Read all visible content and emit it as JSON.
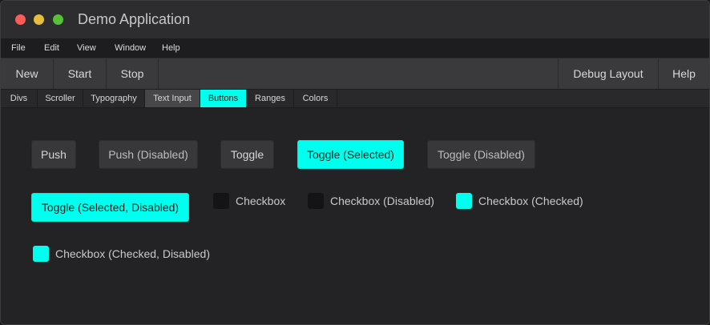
{
  "window": {
    "title": "Demo Application",
    "controls": [
      {
        "name": "close-button",
        "color": "#fc5b57"
      },
      {
        "name": "minimize-button",
        "color": "#e5bf3c"
      },
      {
        "name": "maximize-button",
        "color": "#57c038"
      }
    ]
  },
  "menu": {
    "items": [
      "File",
      "Edit",
      "View",
      "Window",
      "Help"
    ]
  },
  "toolbar": {
    "left": [
      "New",
      "Start",
      "Stop"
    ],
    "right": [
      "Debug Layout",
      "Help"
    ]
  },
  "tabs": {
    "items": [
      "Divs",
      "Scroller",
      "Typography",
      "Text Input",
      "Buttons",
      "Ranges",
      "Colors"
    ],
    "active": "Buttons",
    "hovered": "Text Input"
  },
  "content": {
    "buttons": {
      "push": "Push",
      "push_disabled": "Push (Disabled)",
      "toggle": "Toggle",
      "toggle_selected": "Toggle (Selected)",
      "toggle_disabled": "Toggle (Disabled)",
      "toggle_selected_disabled": "Toggle (Selected, Disabled)"
    },
    "checkboxes": {
      "checkbox": "Checkbox",
      "checkbox_disabled": "Checkbox (Disabled)",
      "checkbox_checked": "Checkbox (Checked)",
      "checkbox_checked_disabled": "Checkbox (Checked, Disabled)"
    }
  },
  "colors": {
    "accent": "#00ffee",
    "background": "#232325",
    "toolbar": "#3a3a3d"
  }
}
